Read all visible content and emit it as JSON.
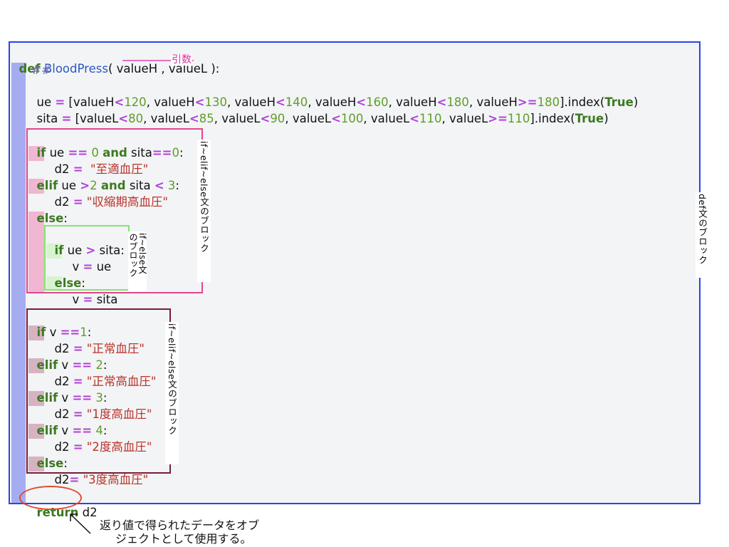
{
  "code": {
    "def_kw": "def",
    "func_name": "BloodPress",
    "open_paren": "( ",
    "param_h": "valueH",
    "comma": " , ",
    "param_l": "valueL",
    "close": " ):",
    "comment": "##",
    "ue_line": {
      "lhs": "ue ",
      "eq": "=",
      "items": [
        {
          "var": "valueH",
          "op": "<",
          "num": "120"
        },
        {
          "var": "valueH",
          "op": "<",
          "num": "130"
        },
        {
          "var": "valueH",
          "op": "<",
          "num": "140"
        },
        {
          "var": "valueH",
          "op": "<",
          "num": "160"
        },
        {
          "var": "valueH",
          "op": "<",
          "num": "180"
        },
        {
          "var": "valueH",
          "op": ">=",
          "num": "180"
        }
      ],
      "tail": "].index(",
      "true_kw": "True",
      "end": ")"
    },
    "sita_line": {
      "lhs": "sita ",
      "eq": "=",
      "items": [
        {
          "var": "valueL",
          "op": "<",
          "num": "80"
        },
        {
          "var": "valueL",
          "op": "<",
          "num": "85"
        },
        {
          "var": "valueL",
          "op": "<",
          "num": "90"
        },
        {
          "var": "valueL",
          "op": "<",
          "num": "100"
        },
        {
          "var": "valueL",
          "op": "<",
          "num": "110"
        },
        {
          "var": "valueL",
          "op": ">=",
          "num": "110"
        }
      ],
      "tail": "].index(",
      "true_kw": "True",
      "end": ")"
    },
    "block1": {
      "if_kw": "if",
      "if_cond_a": " ue ",
      "eqeq": "==",
      "zero": " 0 ",
      "and_kw": "and",
      "if_cond_b": " sita",
      "zero2": "0",
      "colon": ":",
      "d2_a": "d2 ",
      "assign": "=",
      "str_a": "\"至適血圧\"",
      "elif_kw": "elif",
      "elif_a": " ue ",
      "gt": ">",
      "two": "2",
      "elif_b": " sita ",
      "lt": "<",
      "three": " 3",
      "str_b": "\"収縮期高血圧\"",
      "else_kw": "else",
      "inner_if": "if",
      "inner_cond_a": " ue ",
      "inner_cond_b": " sita:",
      "v_ue_a": "v ",
      "v_ue_b": " ue",
      "inner_else": "else",
      "v_sita_b": " sita"
    },
    "block2": {
      "if_kw": "if",
      "v": " v ",
      "one": "1",
      "str1": "\"正常血圧\"",
      "two": " 2",
      "str2": "\"正常高血圧\"",
      "three": " 3",
      "str3": "\"1度高血圧\"",
      "four": " 4",
      "str4": "\"2度高血圧\"",
      "else_kw": "else",
      "d2_tight": "d2",
      "str5": "\"3度高血圧\""
    },
    "return_kw": "return",
    "return_val": " d2"
  },
  "labels": {
    "args": "引数",
    "def_block": "def文のブロック",
    "ifelif_block_1": "if~elif~else文のブロック",
    "ifelse_block_a": "if~else文",
    "ifelse_block_b": "のブロック",
    "ifelif_block_2": "if~elif~else文のブロック",
    "return_note_1": "返り値で得られたデータをオブ",
    "return_note_2": "ジェクトとして使用する。"
  },
  "colors": {
    "panel_border": "#2846e6",
    "def_bar": "#a6acf0",
    "block1_border": "#e0478f",
    "block1_bar": "#f0b6d2",
    "inner_border": "#7ee86c",
    "inner_bar": "#d6f5cf",
    "block2_border": "#7a1d3a",
    "block2_bar": "#d7b3c1",
    "return_circle": "#e04a2f",
    "arg_underline": "#e86fc2"
  }
}
